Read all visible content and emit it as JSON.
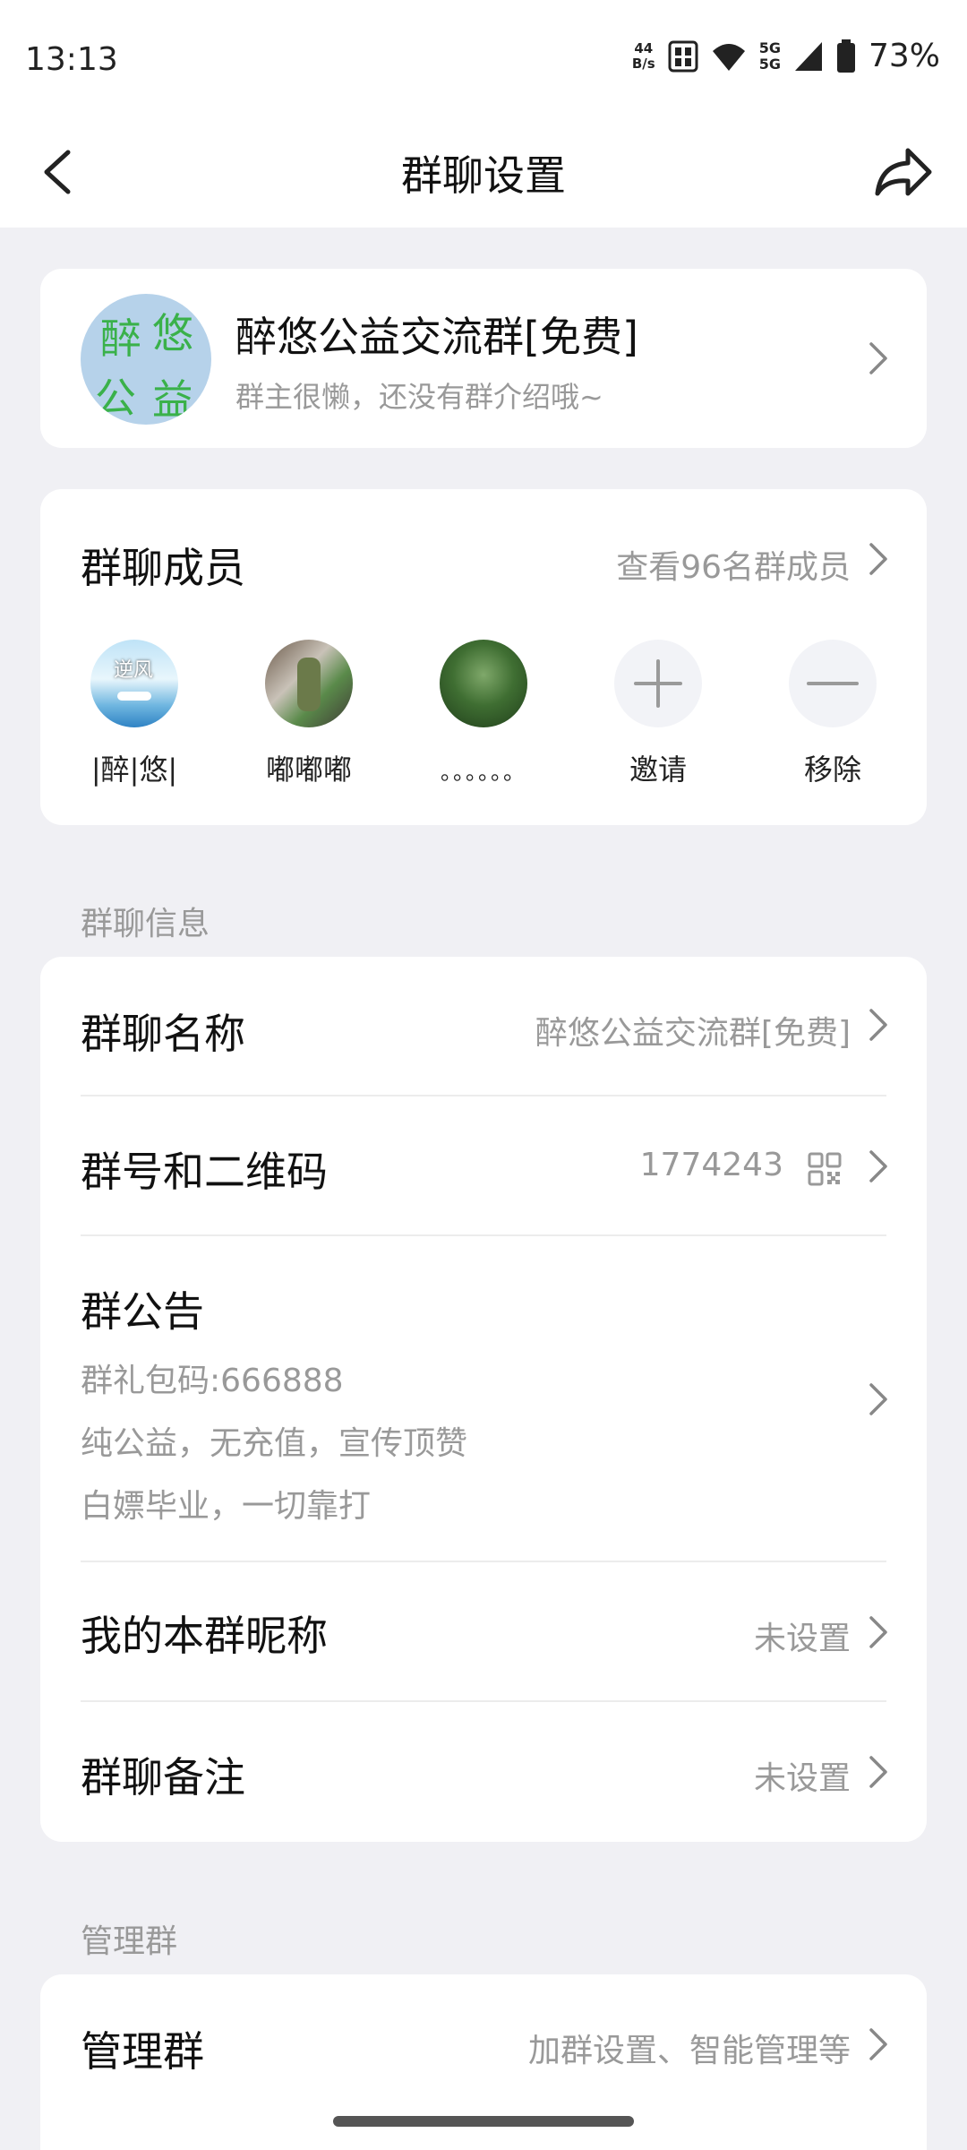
{
  "status_bar": {
    "time": "13:13",
    "net_speed_value": "44",
    "net_speed_unit": "B/s",
    "signal_1": "5G",
    "signal_2": "5G",
    "battery": "73%"
  },
  "nav": {
    "title": "群聊设置"
  },
  "group": {
    "avatar_chars": [
      "醉",
      "悠",
      "公",
      "益"
    ],
    "name": "醉悠公益交流群[免费]",
    "description": "群主很懒，还没有群介绍哦~"
  },
  "members": {
    "title": "群聊成员",
    "view_all": "查看96名群成员",
    "list": [
      {
        "name": "|醉|悠|",
        "avatar_text": "逆风"
      },
      {
        "name": "嘟嘟嘟"
      },
      {
        "name": "。。。。。。"
      }
    ],
    "invite_label": "邀请",
    "remove_label": "移除"
  },
  "info_section": {
    "label": "群聊信息",
    "group_name_label": "群聊名称",
    "group_name_value": "醉悠公益交流群[免费]",
    "group_id_label": "群号和二维码",
    "group_id_value": "1774243",
    "notice_label": "群公告",
    "notice_lines": [
      "群礼包码:666888",
      "纯公益，无充值，宣传顶赞",
      "白嫖毕业，一切靠打"
    ],
    "nickname_label": "我的本群昵称",
    "nickname_value": "未设置",
    "remark_label": "群聊备注",
    "remark_value": "未设置"
  },
  "manage_section": {
    "label": "管理群",
    "row_label": "管理群",
    "row_value": "加群设置、智能管理等"
  },
  "colors": {
    "background": "#f0f0f4",
    "card": "#ffffff",
    "secondary_text": "#999999",
    "avatar_text_green": "#3ab14a"
  }
}
